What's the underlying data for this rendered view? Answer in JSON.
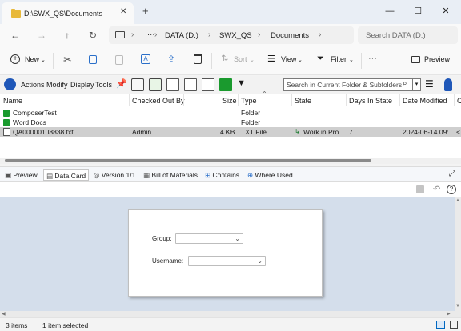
{
  "window": {
    "tab_title": "D:\\SWX_QS\\Documents",
    "tab_close": "✕",
    "new_tab": "+",
    "minimize": "—",
    "maximize": "☐",
    "close": "✕"
  },
  "address_bar": {
    "more": "···",
    "crumbs": [
      "DATA (D:)",
      "SWX_QS",
      "Documents"
    ],
    "search_placeholder": "Search DATA (D:)"
  },
  "command_bar": {
    "new_label": "New",
    "sort_label": "Sort",
    "view_label": "View",
    "filter_label": "Filter",
    "more": "···",
    "preview_label": "Preview"
  },
  "pdm_toolbar": {
    "menus": [
      "Actions",
      "Modify",
      "Display",
      "Tools"
    ],
    "search_placeholder": "Search in Current Folder & Subfolders"
  },
  "file_list": {
    "columns": [
      "Name",
      "Checked Out By",
      "Size",
      "Type",
      "State",
      "Days In State",
      "Date Modified",
      "C"
    ],
    "rows": [
      {
        "name": "ComposerTest",
        "checked_out_by": "",
        "size": "",
        "type": "Folder",
        "state": "",
        "days": "",
        "modified": "",
        "extra": ""
      },
      {
        "name": "Word Docs",
        "checked_out_by": "",
        "size": "",
        "type": "Folder",
        "state": "",
        "days": "",
        "modified": "",
        "extra": ""
      },
      {
        "name": "QA00000108838.txt",
        "checked_out_by": "Admin",
        "size": "4 KB",
        "type": "TXT File",
        "state": "Work in Pro...",
        "days": "7",
        "modified": "2024-06-14 09:...",
        "extra": "<"
      }
    ]
  },
  "detail_tabs": [
    "Preview",
    "Data Card",
    "Version 1/1",
    "Bill of Materials",
    "Contains",
    "Where Used"
  ],
  "data_card": {
    "group_label": "Group:",
    "group_value": "",
    "username_label": "Username:",
    "username_value": ""
  },
  "status_bar": {
    "items_count": "3 items",
    "selection": "1 item selected"
  },
  "colors": {
    "accent": "#0067c0",
    "card_background": "#d4deeb",
    "selected_row": "#cfcfcf",
    "folder": "#e8b93a"
  }
}
